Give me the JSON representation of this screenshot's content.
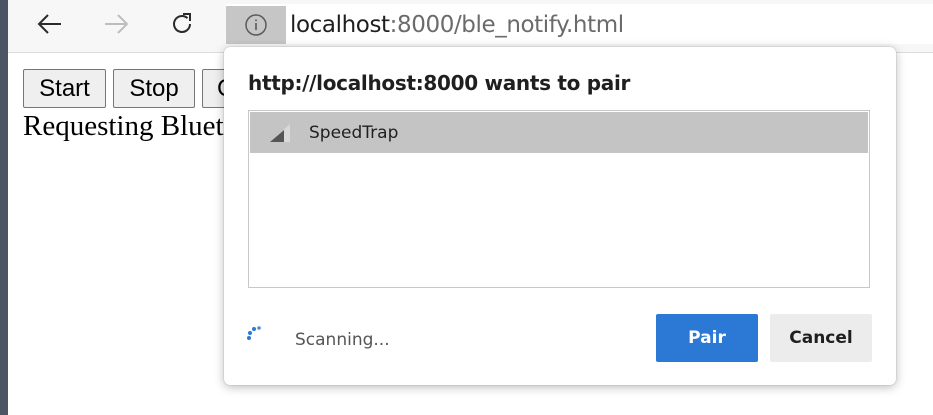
{
  "browser": {
    "url_host": "localhost",
    "url_rest": ":8000/ble_notify.html",
    "icons": {
      "back": "arrow-left-icon",
      "forward": "arrow-right-icon",
      "reload": "reload-icon",
      "site_info": "info-icon"
    }
  },
  "page": {
    "buttons": [
      {
        "label": "Start"
      },
      {
        "label": "Stop"
      },
      {
        "label": "C"
      }
    ],
    "status_text": "Requesting Bluet"
  },
  "dialog": {
    "title": "http://localhost:8000 wants to pair",
    "devices": [
      {
        "name": "SpeedTrap",
        "icon": "signal-strength-icon",
        "selected": true
      }
    ],
    "scanning_text": "Scanning...",
    "pair_label": "Pair",
    "cancel_label": "Cancel",
    "colors": {
      "accent": "#2b79d4",
      "selected_row": "#c4c4c4",
      "spinner": "#2b79d4"
    }
  }
}
